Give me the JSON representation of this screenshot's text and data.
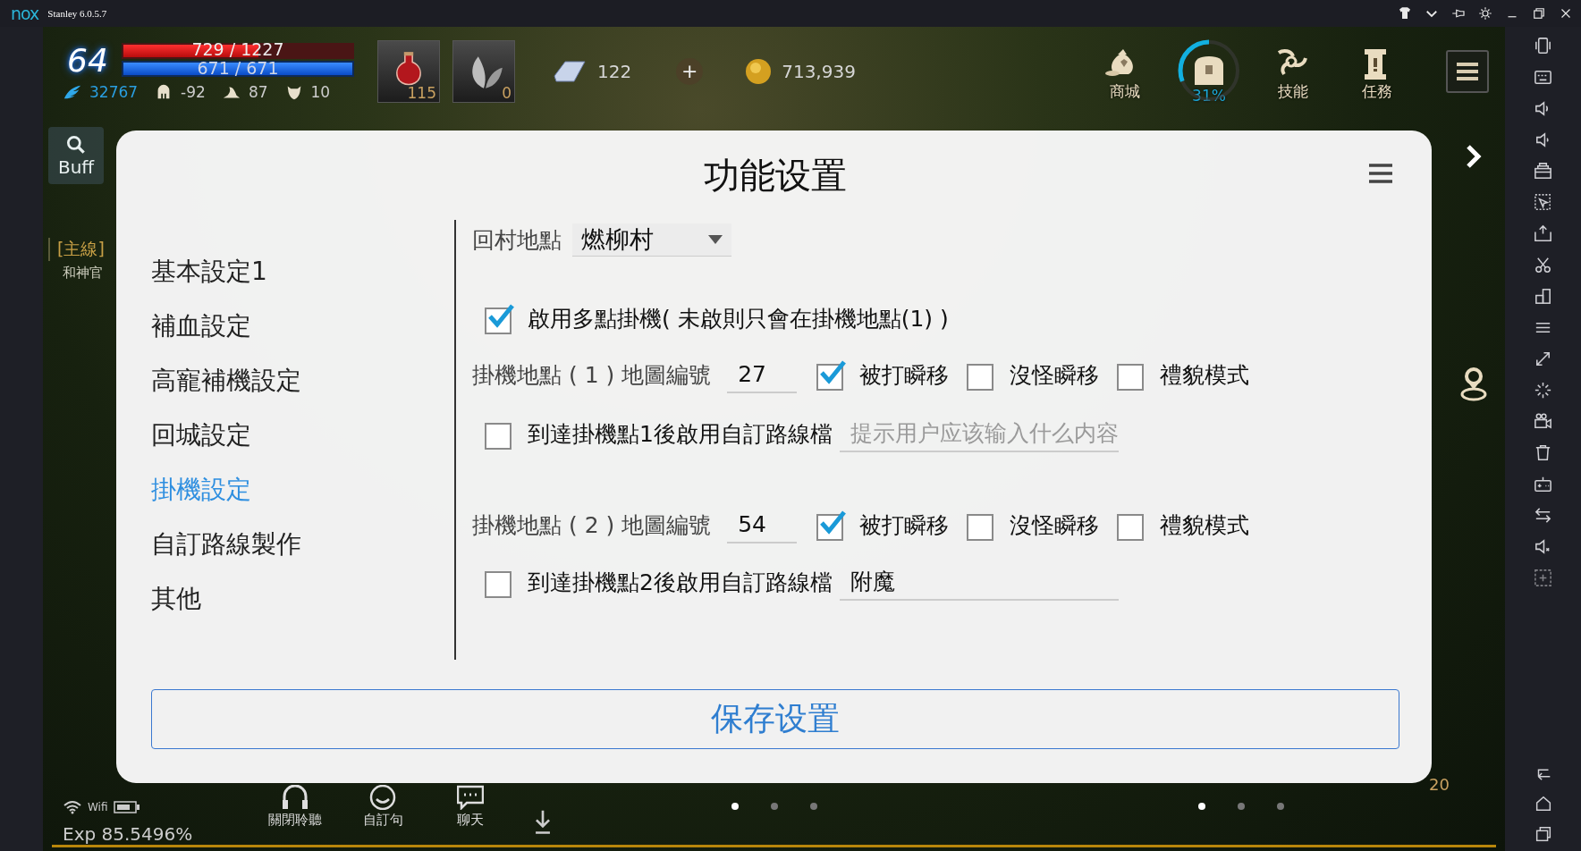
{
  "emulator": {
    "logo": "nox",
    "title": "Stanley 6.0.5.7"
  },
  "hud": {
    "level": "64",
    "hp": {
      "reading": "729 / 1227",
      "level": 0.59
    },
    "mp": {
      "reading": "671 / 671",
      "level": 1
    },
    "stats": [
      {
        "kind": "wing",
        "value": "32767"
      },
      {
        "kind": "helmet",
        "value": "-92"
      },
      {
        "kind": "hat",
        "value": "87"
      },
      {
        "kind": "shield",
        "value": "10"
      }
    ],
    "slots": [
      {
        "kind": "potion",
        "count": "115"
      },
      {
        "kind": "leaf",
        "count": "0"
      }
    ],
    "gems": "122",
    "add": "+",
    "gold": "713,939",
    "buttons": [
      {
        "kind": "shop",
        "label": "商城"
      },
      {
        "kind": "bag",
        "label": "31%",
        "level": 0.31
      },
      {
        "kind": "skill",
        "label": "技能"
      },
      {
        "kind": "quest",
        "label": "任務"
      }
    ]
  },
  "side": {
    "buff": "Buff",
    "quest_tag": "[主線]",
    "quest_text": "和神官"
  },
  "dialog": {
    "title": "功能设置",
    "menu": [
      {
        "label": "基本設定1",
        "selected": false
      },
      {
        "label": "補血設定",
        "selected": false
      },
      {
        "label": "高寵補機設定",
        "selected": false
      },
      {
        "label": "回城設定",
        "selected": false
      },
      {
        "label": "掛機設定",
        "selected": true
      },
      {
        "label": "自訂路線製作",
        "selected": false
      },
      {
        "label": "其他",
        "selected": false
      }
    ],
    "return_village": {
      "label": "回村地點",
      "value": "燃柳村"
    },
    "multi": {
      "checked": true,
      "label": "啟用多點掛機( 未啟則只會在掛機地點(1) )"
    },
    "spots": [
      {
        "label": "掛機地點 ( 1 ) 地圖編號",
        "map": "27",
        "options": [
          {
            "label": "被打瞬移",
            "checked": true
          },
          {
            "label": "沒怪瞬移",
            "checked": false
          },
          {
            "label": "禮貌模式",
            "checked": false
          }
        ],
        "route": {
          "checked": false,
          "label": "到達掛機點1後啟用自訂路線檔",
          "placeholder": "提示用户应该输入什么内容"
        }
      },
      {
        "label": "掛機地點 ( 2 ) 地圖編號",
        "map": "54",
        "options": [
          {
            "label": "被打瞬移",
            "checked": true
          },
          {
            "label": "沒怪瞬移",
            "checked": false
          },
          {
            "label": "禮貌模式",
            "checked": false
          }
        ],
        "route": {
          "checked": false,
          "label": "到達掛機點2後啟用自訂路線檔",
          "value": "附魔"
        }
      }
    ],
    "save": "保存设置"
  },
  "bottom": {
    "wifi": "Wifi",
    "exp": "Exp 85.5496%",
    "chat": [
      {
        "kind": "headset",
        "label": "關閉聆聽"
      },
      {
        "kind": "smile",
        "label": "自訂句"
      },
      {
        "kind": "chat",
        "label": "聊天"
      }
    ],
    "pages_left": [
      {
        "selected": true
      },
      {
        "selected": false
      },
      {
        "selected": false
      }
    ],
    "pages_right": [
      {
        "selected": true
      },
      {
        "selected": false
      },
      {
        "selected": false
      }
    ],
    "count": "20"
  }
}
